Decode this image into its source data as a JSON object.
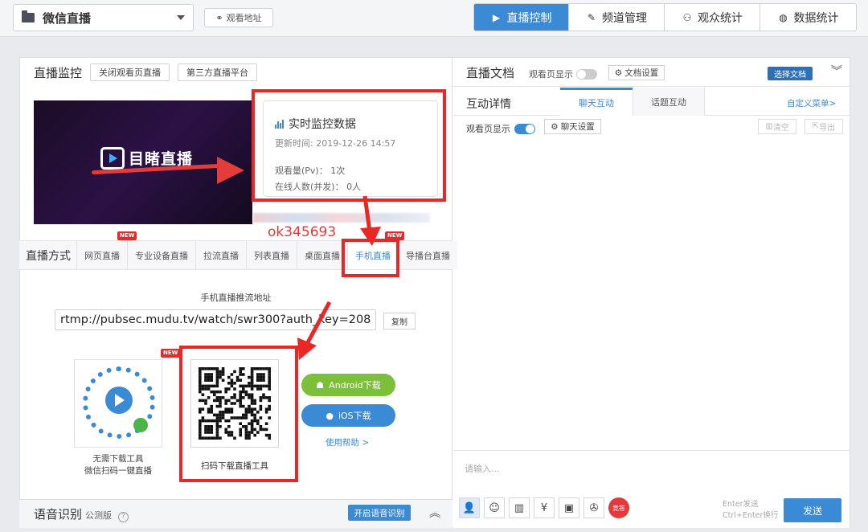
{
  "topbar": {
    "channel": "微信直播",
    "watch_url": "观看地址",
    "tabs": [
      "直播控制",
      "频道管理",
      "观众统计",
      "数据统计"
    ]
  },
  "monitor": {
    "title": "直播监控",
    "btn_close": "关闭观看页直播",
    "btn_third": "第三方直播平台",
    "video_logo": "目睹直播",
    "card_title": "实时监控数据",
    "update_time": "更新时间: 2019-12-26 14:57",
    "pv": "观看量(Pv)： 1次",
    "online": "在线人数(并发)： 0人"
  },
  "watermark": "ok345693",
  "method": {
    "label": "直播方式",
    "tabs": [
      "网页直播",
      "专业设备直播",
      "拉流直播",
      "列表直播",
      "桌面直播",
      "手机直播",
      "导播台直播"
    ],
    "new_badge": "NEW",
    "new_badge_alt": "NEW"
  },
  "push": {
    "title": "手机直播推流地址",
    "url": "rtmp://pubsec.mudu.tv/watch/swr300?auth_key=208",
    "copy": "复制"
  },
  "download": {
    "mini_caption_1": "无需下载工具",
    "mini_caption_2": "微信扫码一键直播",
    "qr_caption": "扫码下载直播工具",
    "android": "Android下载",
    "ios": "iOS下载",
    "help": "使用帮助 >"
  },
  "voice": {
    "label": "语音识别",
    "beta": "公测版",
    "qmark": "?",
    "btn": "开启语音识别"
  },
  "docs": {
    "title": "直播文档",
    "show": "观看页显示",
    "settings": "文档设置",
    "select": "选择文档"
  },
  "interact": {
    "title": "互动详情",
    "tab_chat": "聊天互动",
    "tab_topic": "话题互动",
    "custom_menu": "自定义菜单>",
    "show": "观看页显示",
    "chat_settings": "聊天设置",
    "clear": "清空",
    "export": "导出",
    "placeholder": "请输入...",
    "red_tool": "竞答",
    "hint_1": "Enter发送",
    "hint_2": "Ctrl+Enter换行",
    "send": "发送"
  },
  "colors": {
    "accent": "#3a8ad6",
    "annotation_red": "#e82727",
    "android_green": "#7cbf39"
  }
}
